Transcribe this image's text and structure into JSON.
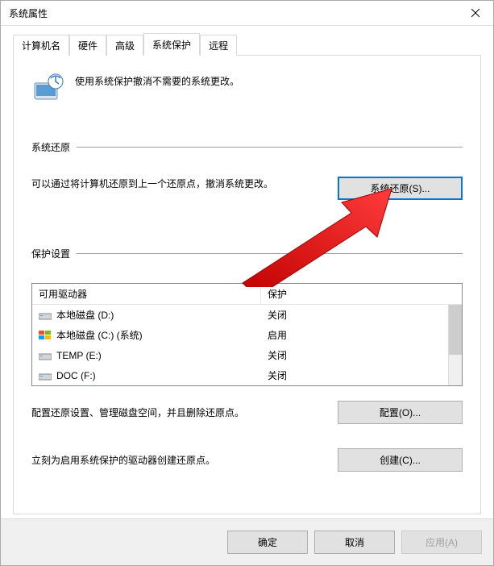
{
  "window": {
    "title": "系统属性"
  },
  "tabs": [
    {
      "label": "计算机名"
    },
    {
      "label": "硬件"
    },
    {
      "label": "高级"
    },
    {
      "label": "系统保护"
    },
    {
      "label": "远程"
    }
  ],
  "intro": {
    "text": "使用系统保护撤消不需要的系统更改。"
  },
  "restore_section": {
    "title": "系统还原",
    "description": "可以通过将计算机还原到上一个还原点，撤消系统更改。",
    "button": "系统还原(S)..."
  },
  "protection_section": {
    "title": "保护设置",
    "headers": {
      "drive": "可用驱动器",
      "protection": "保护"
    },
    "drives": [
      {
        "icon": "drive",
        "name": "本地磁盘 (D:)",
        "status": "关闭"
      },
      {
        "icon": "windrive",
        "name": "本地磁盘 (C:) (系统)",
        "status": "启用"
      },
      {
        "icon": "drive",
        "name": "TEMP (E:)",
        "status": "关闭"
      },
      {
        "icon": "drive",
        "name": "DOC (F:)",
        "status": "关闭"
      }
    ],
    "config_text": "配置还原设置、管理磁盘空间，并且删除还原点。",
    "config_button": "配置(O)...",
    "create_text": "立刻为启用系统保护的驱动器创建还原点。",
    "create_button": "创建(C)..."
  },
  "footer": {
    "ok": "确定",
    "cancel": "取消",
    "apply": "应用(A)"
  }
}
